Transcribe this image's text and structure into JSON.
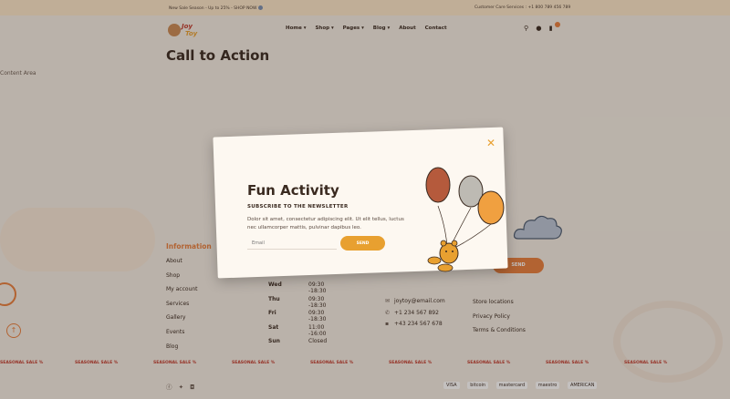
{
  "topbar": {
    "promo": "New Sale Season - Up to 25% - SHOP NOW",
    "customer_service": "Customer Care Services : +1 800 789 456 789"
  },
  "logo": {
    "word1": "Joy",
    "word2": "Toy"
  },
  "nav": [
    "Home ▾",
    "Shop ▾",
    "Pages ▾",
    "Blog ▾",
    "About",
    "Contact"
  ],
  "page": {
    "title": "Call to Action",
    "content_area": "Content Area"
  },
  "footer": {
    "info_heading": "Information",
    "info_items": [
      "About",
      "Shop",
      "My account",
      "Services",
      "Gallery",
      "Events",
      "Blog"
    ],
    "hours": [
      {
        "day": "Wed",
        "time": "09:30 -18:30"
      },
      {
        "day": "Thu",
        "time": "09:30 -18:30"
      },
      {
        "day": "Fri",
        "time": "09:30 -18:30"
      },
      {
        "day": "Sat",
        "time": "11:00 -16:00"
      },
      {
        "day": "Sun",
        "time": "Closed"
      }
    ],
    "contact": [
      "joytoy@email.com",
      "+1 234 567 892",
      "+43 234 567 678"
    ],
    "links": [
      "Store locations",
      "Privacy Policy",
      "Terms & Conditions"
    ],
    "send_label": "SEND",
    "payments": [
      "VISA",
      "bitcoin",
      "mastercard",
      "maestro",
      "AMERICAN"
    ]
  },
  "marquee": "SEASONAL SALE %",
  "modal": {
    "title": "Fun Activity",
    "subtitle": "SUBSCRIBE TO THE NEWSLETTER",
    "description": "Dolor sit amet, consectetur adipiscing elit. Ut elit tellus, luctus nec ullamcorper mattis, pulvinar dapibus leo.",
    "email_placeholder": "Email",
    "send_label": "SEND",
    "close_glyph": "✕"
  },
  "colors": {
    "accent": "#e87e3c",
    "send": "#e8a030",
    "title": "#3a2a20",
    "balloon_red": "#b55a3c",
    "balloon_grey": "#bdbab3",
    "balloon_orange": "#f0a040"
  }
}
